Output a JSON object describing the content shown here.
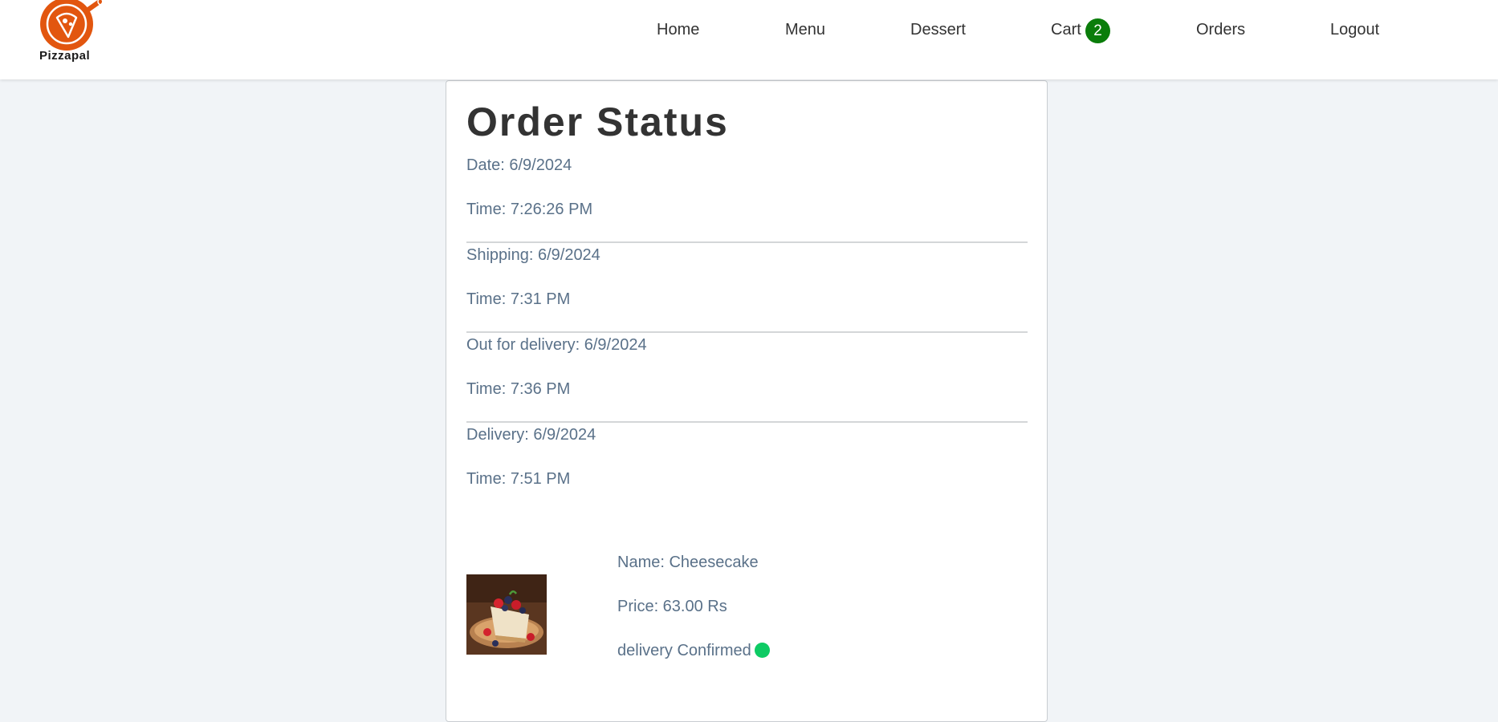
{
  "brand": {
    "name": "Pizzapal",
    "accent": "#e2560f"
  },
  "nav": {
    "home": "Home",
    "menu": "Menu",
    "dessert": "Dessert",
    "cart": "Cart",
    "cart_count": "2",
    "orders": "Orders",
    "logout": "Logout",
    "badge_color": "#0a7d0a"
  },
  "order": {
    "title": "Order Status",
    "date": "Date: 6/9/2024",
    "time": "Time: 7:26:26 PM",
    "shipping": "Shipping: 6/9/2024",
    "shipping_time": "Time: 7:31 PM",
    "out_for_delivery": "Out for delivery: 6/9/2024",
    "out_for_delivery_time": "Time: 7:36 PM",
    "delivery": "Delivery: 6/9/2024",
    "delivery_time": "Time: 7:51 PM"
  },
  "item": {
    "name": "Name: Cheesecake",
    "price": "Price: 63.00 Rs",
    "status": "delivery Confirmed",
    "status_color": "#0ecb64"
  }
}
